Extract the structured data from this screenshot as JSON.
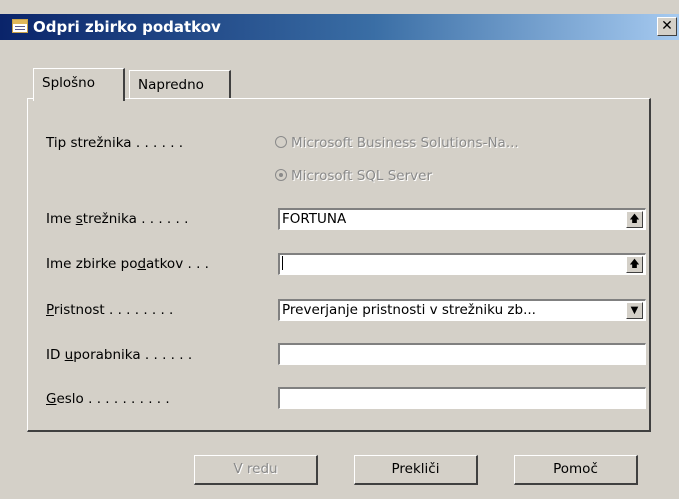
{
  "window": {
    "title": "Odpri zbirko podatkov",
    "close_glyph": "✕"
  },
  "tabs": [
    {
      "label": "Splošno",
      "active": true
    },
    {
      "label": "Napredno",
      "active": false
    }
  ],
  "form": {
    "server_type": {
      "label": "Tip strežnika",
      "dots": ". . . . . .",
      "options": [
        {
          "label": "Microsoft Business Solutions-Na...",
          "checked": false,
          "enabled": false
        },
        {
          "label": "Microsoft SQL Server",
          "checked": true,
          "enabled": false
        }
      ]
    },
    "server_name": {
      "label_pre": "Ime ",
      "label_mn": "s",
      "label_post": "trežnika",
      "dots": ". . . . . .",
      "value": "FORTUNA"
    },
    "database_name": {
      "label_pre": "Ime zbirke po",
      "label_mn": "d",
      "label_post": "atkov",
      "dots": ". . .",
      "value": ""
    },
    "authentication": {
      "label_pre": "",
      "label_mn": "P",
      "label_post": "ristnost",
      "dots": ". . . . . . . .",
      "value": "Preverjanje pristnosti v strežniku zb..."
    },
    "user_id": {
      "label_pre": "ID ",
      "label_mn": "u",
      "label_post": "porabnika",
      "dots": ". . . . . .",
      "value": ""
    },
    "password": {
      "label_pre": "",
      "label_mn": "G",
      "label_post": "eslo",
      "dots": ". . . . . . . . . .",
      "value": ""
    }
  },
  "buttons": {
    "ok": "V redu",
    "cancel": "Prekliči",
    "help": "Pomoč"
  },
  "icons": {
    "lookup": "up-arrow-icon",
    "dropdown": "chevron-down-icon"
  }
}
